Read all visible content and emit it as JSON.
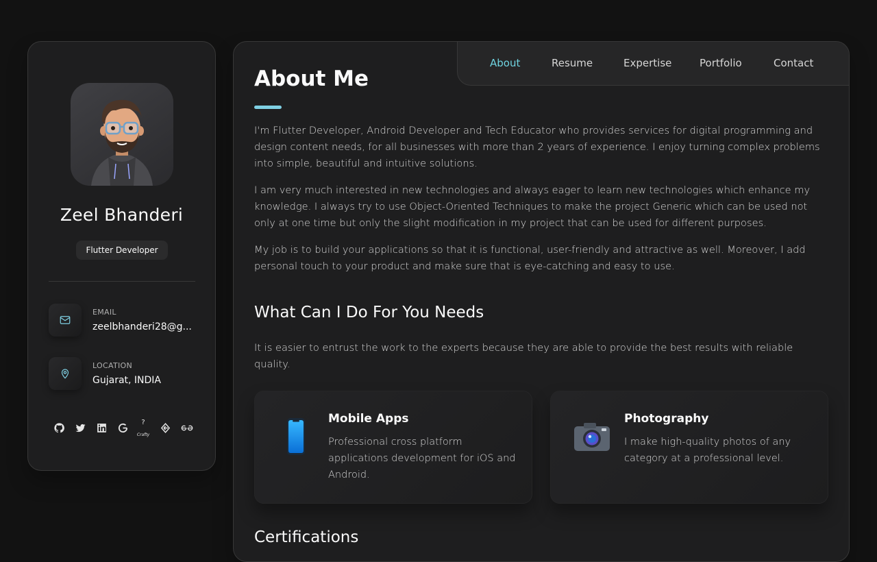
{
  "profile": {
    "name": "Zeel Bhanderi",
    "role": "Flutter Developer",
    "email_title": "EMAIL",
    "email": "zeelbhanderi28@g...",
    "location_title": "LOCATION",
    "location": "Gujarat, INDIA",
    "social_icons": [
      "github-icon",
      "twitter-icon",
      "linkedin-icon",
      "google-icon",
      "crafty-icon",
      "elephant-icon",
      "geeksforgeeks-icon"
    ],
    "crafty_label": "Crafty",
    "crafty_mark": "?"
  },
  "nav": {
    "items": [
      "About",
      "Resume",
      "Expertise",
      "Portfolio",
      "Contact"
    ],
    "active": "About"
  },
  "about": {
    "title": "About Me",
    "p1": "I'm Flutter Developer, Android Developer and Tech Educator who provides services for digital programming and design content needs, for all businesses with more than 2 years of experience. I enjoy turning complex problems into simple, beautiful and intuitive solutions.",
    "p2": "I am very much interested in new technologies and always eager to learn new technologies which enhance my knowledge. I always try to use Object-Oriented Techniques to make the project Generic which can be used not only at one time but only the slight modification in my project that can be used for different purposes.",
    "p3": "My job is to build your applications so that it is functional, user-friendly and attractive as well. Moreover, I add personal touch to your product and make sure that is eye-catching and easy to use."
  },
  "services": {
    "title": "What Can I Do For You Needs",
    "intro": "It is easier to entrust the work to the experts because they are able to provide the best results with reliable quality.",
    "items": [
      {
        "title": "Mobile Apps",
        "text": "Professional cross platform applications development for iOS and Android.",
        "icon": "smartphone-icon"
      },
      {
        "title": "Photography",
        "text": "I make high-quality photos of any category at a professional level.",
        "icon": "camera-icon"
      }
    ]
  },
  "certifications": {
    "title": "Certifications"
  },
  "colors": {
    "accent": "#6fd3e0",
    "background": "#121212",
    "card": "#1e1e1f"
  }
}
